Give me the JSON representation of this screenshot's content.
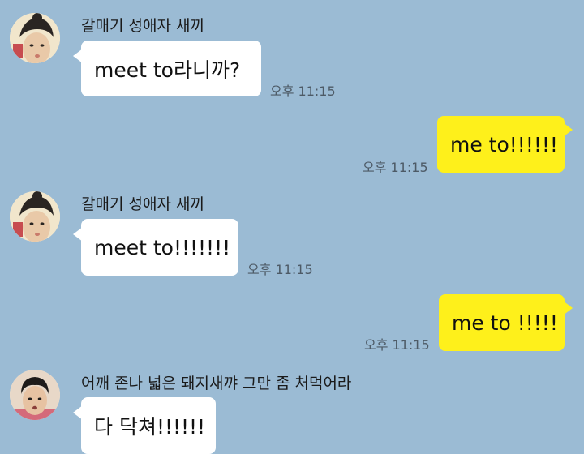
{
  "messages": [
    {
      "direction": "in",
      "sender": "갈매기 성애자 새끼",
      "text": "meet to라니까?",
      "time": "오후 11:15"
    },
    {
      "direction": "out",
      "text": "me to!!!!!!",
      "time": "오후 11:15"
    },
    {
      "direction": "in",
      "sender": "갈매기 성애자 새끼",
      "text": "meet to!!!!!!!",
      "time": "오후 11:15"
    },
    {
      "direction": "out",
      "text": "me to !!!!!",
      "time": "오후 11:15"
    },
    {
      "direction": "in",
      "sender": "어깨 존나 넓은 돼지새꺄 그만 좀 처먹어라",
      "text": "다 닥쳐!!!!!!",
      "time": ""
    }
  ],
  "colors": {
    "background": "#9bbbd4",
    "incoming_bubble": "#ffffff",
    "outgoing_bubble": "#fef01b"
  },
  "icons": {
    "avatar_1": "profile-photo-icon",
    "avatar_2": "profile-photo-icon"
  }
}
